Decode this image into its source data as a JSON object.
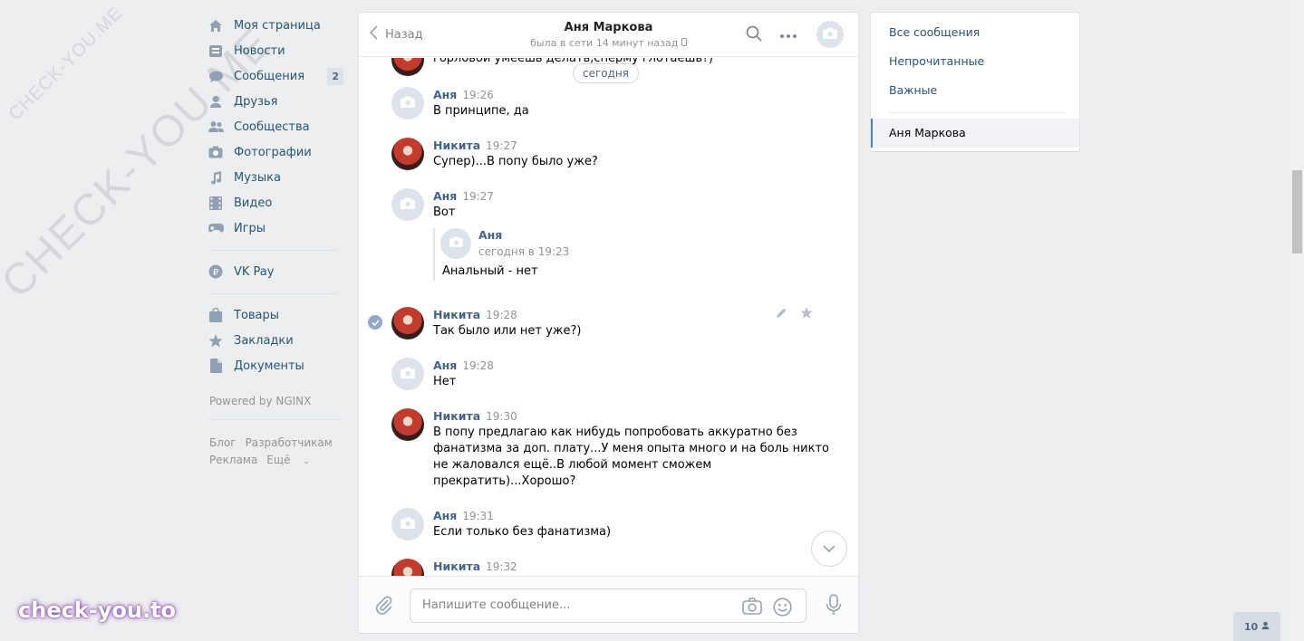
{
  "watermark": {
    "small": "CHECK-YOU.ME",
    "large": "CHECK-YOU.ME",
    "brand": "check-you.to"
  },
  "nav": {
    "items": [
      {
        "label": "Моя страница",
        "icon": "home-icon"
      },
      {
        "label": "Новости",
        "icon": "news-icon"
      },
      {
        "label": "Сообщения",
        "icon": "messages-icon",
        "badge": "2"
      },
      {
        "label": "Друзья",
        "icon": "friends-icon"
      },
      {
        "label": "Сообщества",
        "icon": "groups-icon"
      },
      {
        "label": "Фотографии",
        "icon": "photo-icon"
      },
      {
        "label": "Музыка",
        "icon": "music-icon"
      },
      {
        "label": "Видео",
        "icon": "video-icon"
      },
      {
        "label": "Игры",
        "icon": "games-icon"
      },
      {
        "label": "VK Pay",
        "icon": "vkpay-icon"
      },
      {
        "label": "Товары",
        "icon": "shop-icon"
      },
      {
        "label": "Закладки",
        "icon": "star-icon"
      },
      {
        "label": "Документы",
        "icon": "document-icon"
      }
    ],
    "powered": "Powered by NGINX",
    "footer": [
      "Блог",
      "Разработчикам",
      "Реклама",
      "Ещё"
    ]
  },
  "chat": {
    "back": "Назад",
    "peer_name": "Аня Маркова",
    "peer_status": "была в сети 14 минут назад",
    "top_partial": "горловой умеешь делать,сперму глотаешь?)",
    "day": "сегодня",
    "messages": [
      {
        "author": "Аня",
        "time": "19:26",
        "text": "В принципе, да"
      },
      {
        "author": "Никита",
        "time": "19:27",
        "text": "Супер)...В попу было уже?"
      },
      {
        "author": "Аня",
        "time": "19:27",
        "text": "Вот"
      },
      {
        "author": "Никита",
        "time": "19:28",
        "text": "Так было или нет уже?)"
      },
      {
        "author": "Аня",
        "time": "19:28",
        "text": "Нет"
      },
      {
        "author": "Никита",
        "time": "19:30",
        "text_lines": [
          "В попу предлагаю как нибудь попробовать аккуратно без",
          "фанатизма за доп. плату...У меня опыта много и на боль никто",
          "не жаловался ещё..В любой момент сможем",
          "прекратить)...Хорошо?"
        ]
      },
      {
        "author": "Аня",
        "time": "19:31",
        "text": "Если только без фанатизма)"
      },
      {
        "author": "Никита",
        "time": "19:32",
        "text": ""
      }
    ],
    "forward": {
      "author": "Аня",
      "date": "сегодня в 19:23",
      "text": "Анальный - нет"
    },
    "composer_placeholder": "Напишите сообщение..."
  },
  "right": {
    "items": [
      "Все сообщения",
      "Непрочитанные",
      "Важные"
    ],
    "selected": "Аня Маркова"
  },
  "online_count": "10",
  "colors": {
    "link": "#285473",
    "author": "#42648b",
    "accent": "#5181b8",
    "bg": "#edeef0"
  }
}
